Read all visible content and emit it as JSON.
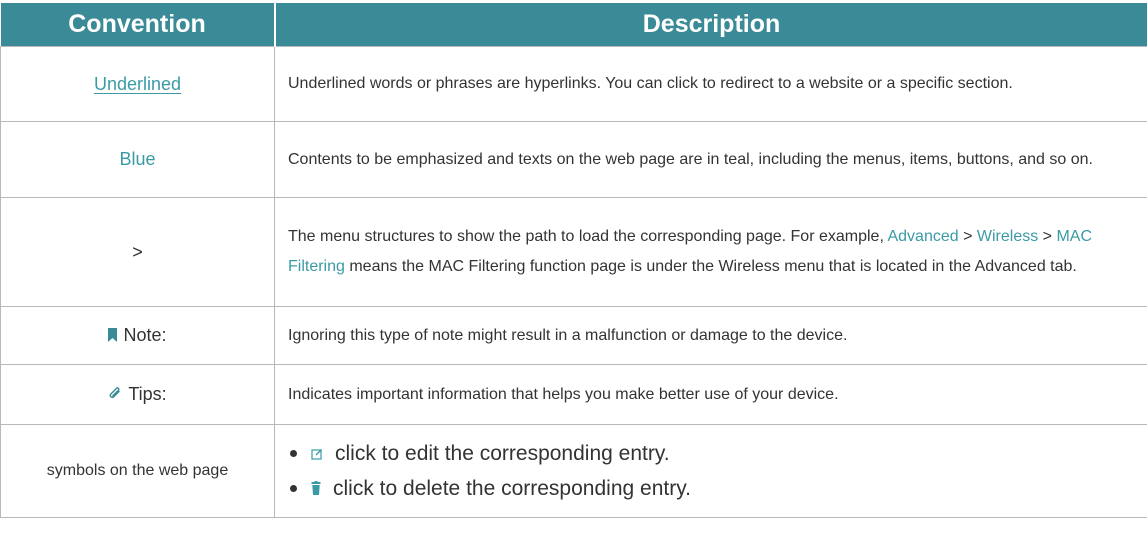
{
  "header": {
    "col1": "Convention",
    "col2": "Description"
  },
  "rows": [
    {
      "convention": "Underlined",
      "description": "Underlined words or phrases are hyperlinks. You can click to redirect to a website or a specific section."
    },
    {
      "convention": "Blue",
      "description": "Contents to be emphasized and texts on the web page are in teal, including the menus, items, buttons, and so on."
    },
    {
      "convention": ">",
      "description_parts": {
        "intro": "The menu structures to show the path to load the corresponding page. For example,",
        "menu1": "Advanced",
        "sep1": " > ",
        "menu2": "Wireless",
        "sep2": " > ",
        "menu3": "MAC Filtering",
        "tail": " means the MAC Filtering function page is under the Wireless menu that is located in the Advanced tab."
      }
    },
    {
      "convention": "Note:",
      "icon": "bookmark-icon",
      "description": "Ignoring this type of note might result in a malfunction or damage to the device."
    },
    {
      "convention": "Tips:",
      "icon": "paperclip-icon",
      "description": "Indicates important information that helps you make better use of your device."
    },
    {
      "convention": "symbols on the web page",
      "items": [
        {
          "icon": "edit-icon",
          "text": "click to edit the corresponding entry."
        },
        {
          "icon": "trash-icon",
          "text": "click to delete the corresponding entry."
        }
      ]
    }
  ],
  "colors": {
    "header_bg": "#3a8b97",
    "accent_teal": "#3a9ba6",
    "text": "#333333",
    "border": "#b8b8b8"
  }
}
